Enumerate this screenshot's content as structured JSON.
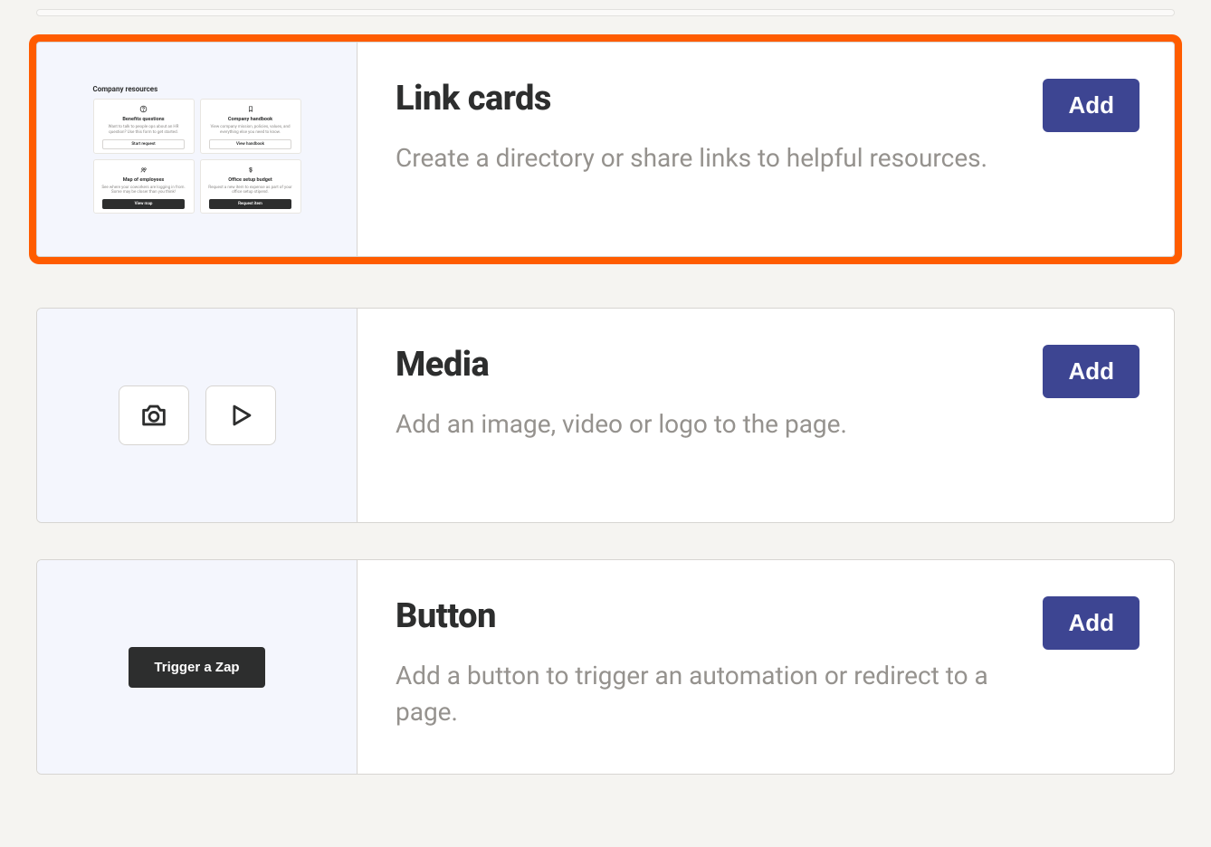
{
  "options": [
    {
      "title": "Link cards",
      "description": "Create a directory or share links to helpful resources.",
      "add_label": "Add",
      "highlighted": true,
      "preview": {
        "heading": "Company resources",
        "tiles": [
          {
            "icon": "help",
            "title": "Benefits questions",
            "desc": "Want to talk to people ops about an HR question? Use this form to get started.",
            "button": "Start request",
            "dark": false
          },
          {
            "icon": "bookmark",
            "title": "Company handbook",
            "desc": "View company mission, policies, values, and everything else you need to know.",
            "button": "View handbook",
            "dark": false
          },
          {
            "icon": "people",
            "title": "Map of employees",
            "desc": "See where your coworkers are logging in from. Some may be closer than you think!",
            "button": "View map",
            "dark": true
          },
          {
            "icon": "dollar",
            "title": "Office setup budget",
            "desc": "Request a new item to expense as part of your office setup stipend.",
            "button": "Request item",
            "dark": true
          }
        ]
      }
    },
    {
      "title": "Media",
      "description": "Add an image, video or logo to the page.",
      "add_label": "Add",
      "highlighted": false
    },
    {
      "title": "Button",
      "description": "Add a button to trigger an automation or redirect to a page.",
      "add_label": "Add",
      "highlighted": false,
      "preview": {
        "button_label": "Trigger a Zap"
      }
    }
  ]
}
